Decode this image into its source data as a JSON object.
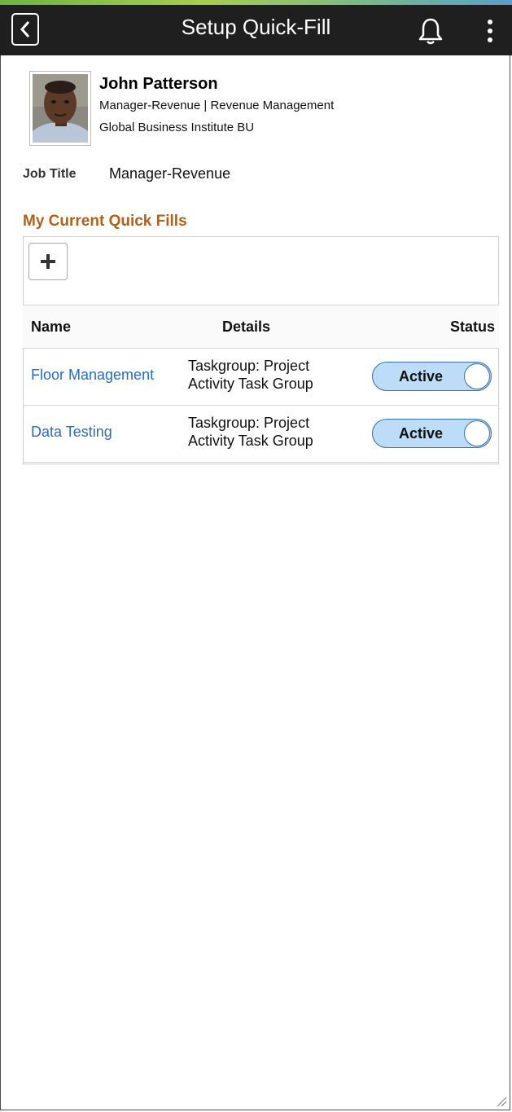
{
  "header": {
    "title": "Setup Quick-Fill",
    "back_icon": "chevron-left-icon",
    "notification_icon": "bell-icon",
    "menu_icon": "vertical-ellipsis-icon"
  },
  "profile": {
    "name": "John Patterson",
    "position": "Manager-Revenue | Revenue Management",
    "business_unit": "Global Business Institute BU",
    "job_title_label": "Job Title",
    "job_title_value": "Manager-Revenue"
  },
  "quick_fills": {
    "section_title": "My Current Quick Fills",
    "add_icon": "plus-icon",
    "columns": [
      "Name",
      "Details",
      "Status"
    ],
    "rows": [
      {
        "name": "Floor Management",
        "details_line1": "Taskgroup: Project",
        "details_line2": "Activity Task Group",
        "status": "Active"
      },
      {
        "name": "Data Testing",
        "details_line1": "Taskgroup: Project",
        "details_line2": "Activity Task Group",
        "status": "Active"
      }
    ]
  },
  "colors": {
    "header_bg": "#1f1f1f",
    "section_title": "#b0611a",
    "link": "#2c6db3",
    "toggle_bg": "#bcdcf7"
  }
}
